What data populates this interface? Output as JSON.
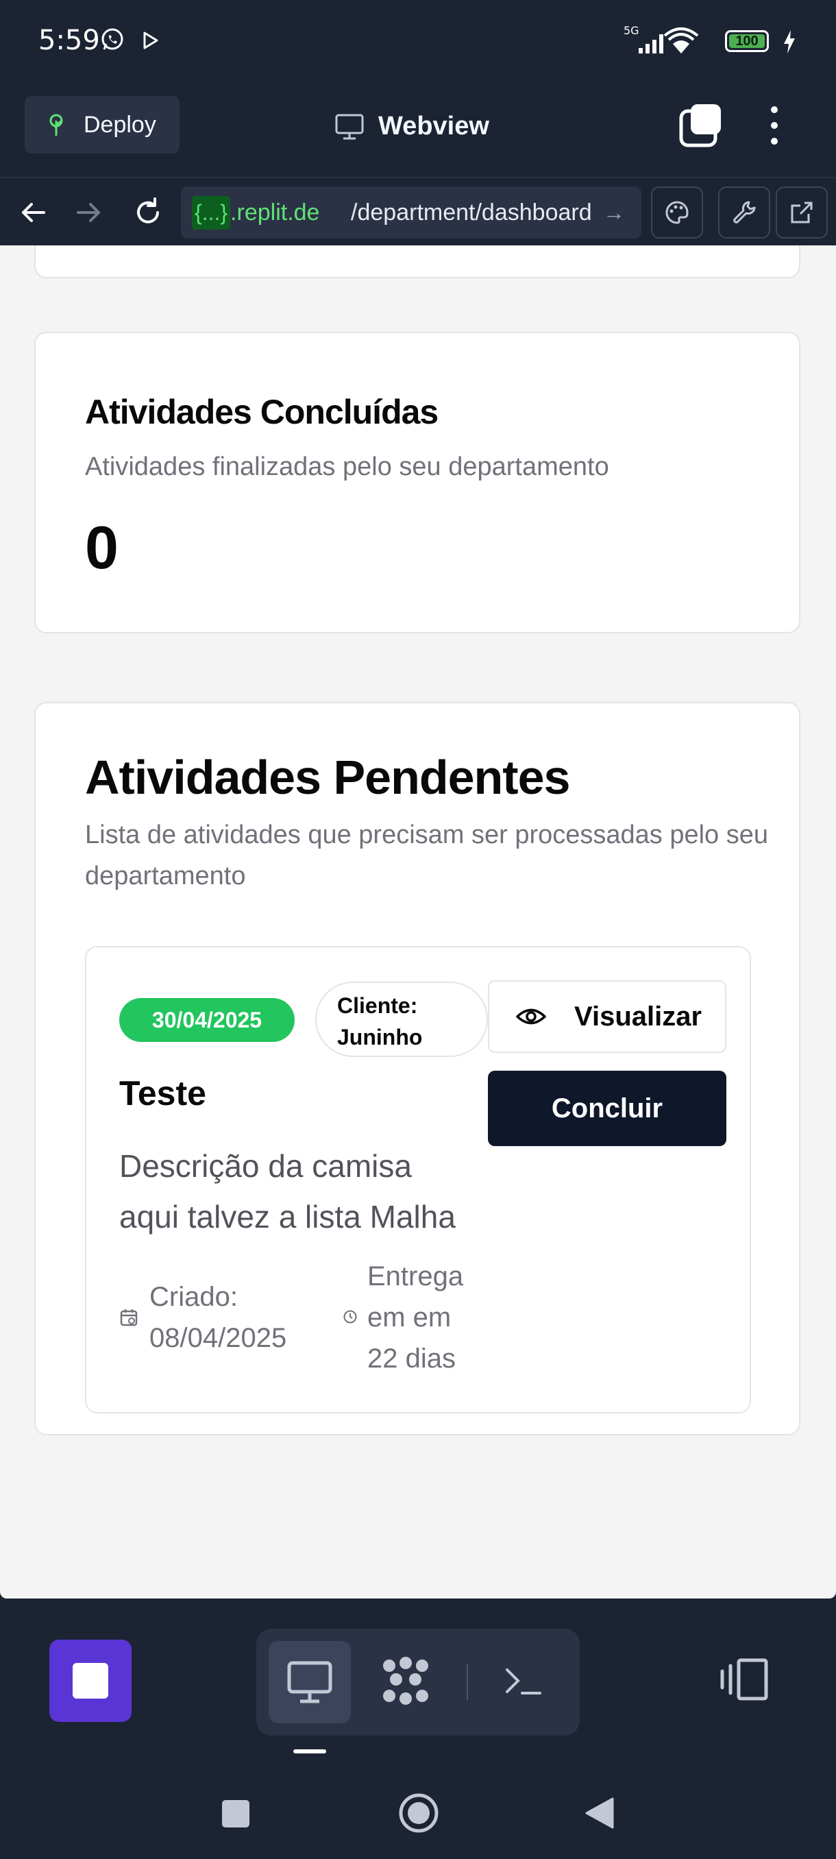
{
  "status_bar": {
    "time": "5:59",
    "network": "5G",
    "battery": "100"
  },
  "app_header": {
    "deploy_label": "Deploy",
    "title": "Webview"
  },
  "url_bar": {
    "tag": "{...}",
    "host": ".replit.de",
    "path": "/department/dashboard"
  },
  "completed_card": {
    "title": "Atividades Concluídas",
    "description": "Atividades finalizadas pelo seu departamento",
    "count": "0"
  },
  "pending_card": {
    "title": "Atividades Pendentes",
    "description": "Lista de atividades que precisam ser processadas pelo seu departamento",
    "activities": [
      {
        "date_badge": "30/04/2025",
        "client_label": "Cliente:",
        "client_name": "Juninho",
        "view_label": "Visualizar",
        "complete_label": "Concluir",
        "title": "Teste",
        "description_line1": "Descrição da camisa",
        "description_line2": "aqui talvez a lista Malha",
        "created_label": "Criado:",
        "created_date": "08/04/2025",
        "due_line1": "Entrega",
        "due_line2": "em em",
        "due_line3": "22 dias"
      }
    ]
  },
  "colors": {
    "app_bg": "#1c2333",
    "page_bg": "#f4f4f5",
    "badge_green": "#22c55e",
    "primary_button": "#0f172a",
    "stop_purple": "#5a35d6",
    "url_green": "#5ee375"
  },
  "icons": {
    "deploy": "sprout-icon",
    "webview": "monitor-icon",
    "tabs": "tabs-icon",
    "more": "kebab-menu-icon",
    "back": "arrow-left-icon",
    "forward": "arrow-right-icon",
    "reload": "reload-icon",
    "palette": "palette-icon",
    "devtools": "wrench-icon",
    "open_external": "external-link-icon",
    "view": "eye-icon",
    "calendar": "calendar-icon",
    "clock": "clock-icon"
  }
}
